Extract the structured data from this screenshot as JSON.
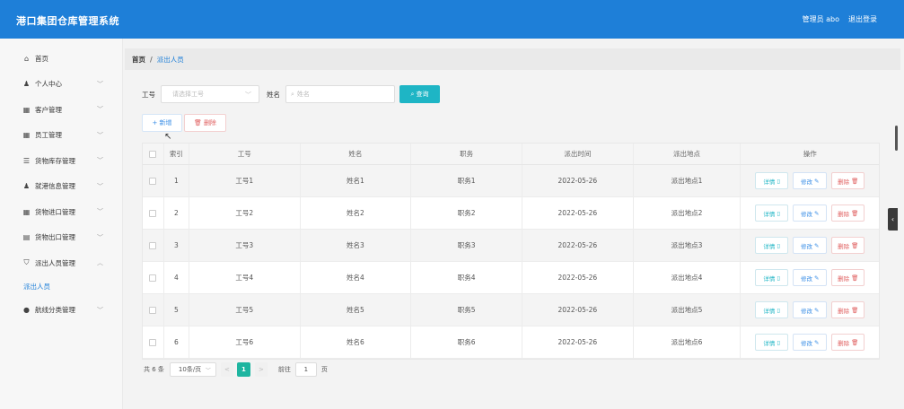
{
  "header": {
    "title": "港口集团仓库管理系统",
    "user": "管理员 abo",
    "logout": "退出登录"
  },
  "sidebar": {
    "items": [
      {
        "label": "首页",
        "icon": "home-icon",
        "glyph": "⌂",
        "chev": ""
      },
      {
        "label": "个人中心",
        "icon": "user-icon",
        "glyph": "♟",
        "chev": "﹀"
      },
      {
        "label": "客户管理",
        "icon": "grid-icon",
        "glyph": "▦",
        "chev": "﹀"
      },
      {
        "label": "员工管理",
        "icon": "grid-icon",
        "glyph": "▦",
        "chev": "﹀"
      },
      {
        "label": "货物库存管理",
        "icon": "list-icon",
        "glyph": "☰",
        "chev": "﹀"
      },
      {
        "label": "就港信息管理",
        "icon": "user-icon",
        "glyph": "♟",
        "chev": "﹀"
      },
      {
        "label": "货物进口管理",
        "icon": "grid-icon",
        "glyph": "▦",
        "chev": "﹀"
      },
      {
        "label": "货物出口管理",
        "icon": "box-icon",
        "glyph": "▤",
        "chev": "﹀"
      },
      {
        "label": "派出人员管理",
        "icon": "shield-icon",
        "glyph": "⛉",
        "chev": "︿"
      }
    ],
    "sub_item": "派出人员",
    "last_item": {
      "label": "航线分类管理",
      "icon": "location-icon",
      "glyph": "●",
      "chev": "﹀"
    }
  },
  "breadcrumb": {
    "home": "首页",
    "sep": "/",
    "current": "派出人员"
  },
  "search": {
    "label1": "工号",
    "select_placeholder": "请选择工号",
    "label2": "姓名",
    "input_placeholder": "姓名",
    "button": "查询"
  },
  "actions": {
    "add": "+ 新增",
    "delete": "删除"
  },
  "table": {
    "headers": [
      "",
      "索引",
      "工号",
      "姓名",
      "职务",
      "派出时间",
      "派出地点",
      "操作"
    ],
    "rows": [
      {
        "idx": "1",
        "no": "工号1",
        "name": "姓名1",
        "duty": "职务1",
        "time": "2022-05-26",
        "place": "派出地点1"
      },
      {
        "idx": "2",
        "no": "工号2",
        "name": "姓名2",
        "duty": "职务2",
        "time": "2022-05-26",
        "place": "派出地点2"
      },
      {
        "idx": "3",
        "no": "工号3",
        "name": "姓名3",
        "duty": "职务3",
        "time": "2022-05-26",
        "place": "派出地点3"
      },
      {
        "idx": "4",
        "no": "工号4",
        "name": "姓名4",
        "duty": "职务4",
        "time": "2022-05-26",
        "place": "派出地点4"
      },
      {
        "idx": "5",
        "no": "工号5",
        "name": "姓名5",
        "duty": "职务5",
        "time": "2022-05-26",
        "place": "派出地点5"
      },
      {
        "idx": "6",
        "no": "工号6",
        "name": "姓名6",
        "duty": "职务6",
        "time": "2022-05-26",
        "place": "派出地点6"
      }
    ],
    "op_view": "详情",
    "op_edit": "修改",
    "op_del": "删除"
  },
  "pager": {
    "total": "共 6 条",
    "size": "10条/页",
    "prev": "<",
    "current": "1",
    "next": ">",
    "goto_prefix": "前往",
    "goto_value": "1",
    "goto_suffix": "页"
  },
  "colors": {
    "header_bg": "#1e7fd8",
    "accent_teal": "#1eb5c5",
    "danger": "#e06060"
  }
}
